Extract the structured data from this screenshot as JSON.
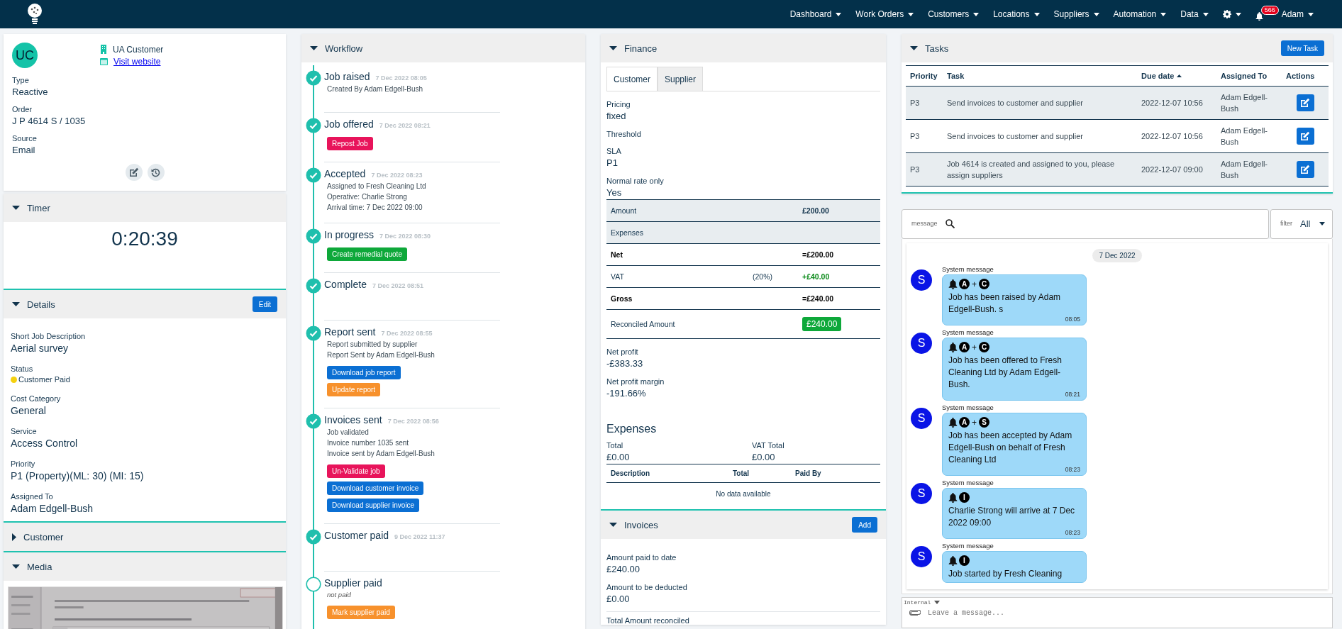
{
  "nav": {
    "items": [
      {
        "kind": "menu",
        "label": "Dashboard"
      },
      {
        "kind": "menu",
        "label": "Work Orders"
      },
      {
        "kind": "menu",
        "label": "Customers"
      },
      {
        "kind": "menu",
        "label": "Locations"
      },
      {
        "kind": "menu",
        "label": "Suppliers"
      },
      {
        "kind": "menu",
        "label": "Automation"
      },
      {
        "kind": "menu",
        "label": "Data"
      },
      {
        "kind": "settings"
      },
      {
        "kind": "notifications",
        "badge": "566"
      },
      {
        "kind": "menu",
        "label": "Adam"
      }
    ]
  },
  "customer_card": {
    "avatar": "UC",
    "name": "UA Customer",
    "link": "Visit website",
    "fields": [
      {
        "label": "Type",
        "value": "Reactive"
      },
      {
        "label": "Order",
        "value": "J P 4614 S / 1035"
      },
      {
        "label": "Source",
        "value": "Email"
      }
    ]
  },
  "timer": {
    "title": "Timer",
    "expanded": true,
    "time": "0:20:39"
  },
  "details": {
    "title": "Details",
    "expanded": true,
    "button": "Edit",
    "fields": [
      {
        "label": "Short Job Description",
        "value": "Aerial survey"
      },
      {
        "label": "Status",
        "value": "Customer Paid",
        "color": "#f5d10f"
      },
      {
        "label": "Cost Category",
        "value": "General"
      },
      {
        "label": "Service",
        "value": "Access Control"
      },
      {
        "label": "Priority",
        "value": "P1 (Property)(ML: 30) (MI: 15)"
      },
      {
        "label": "Assigned To",
        "value": "Adam Edgell-Bush"
      }
    ]
  },
  "customer_section": {
    "title": "Customer",
    "expanded": false
  },
  "media": {
    "title": "Media",
    "expanded": true
  },
  "workflow": {
    "title": "Workflow",
    "expanded": true,
    "steps": [
      {
        "title": "Job raised",
        "date": "7 Dec 2022 08:05",
        "done": true,
        "lines": [
          "Created By Adam Edgell-Bush"
        ]
      },
      {
        "title": "Job offered",
        "date": "7 Dec 2022 08:21",
        "done": true,
        "buttons": [
          {
            "label": "Repost Job",
            "color": "#e8145b"
          }
        ]
      },
      {
        "title": "Accepted",
        "date": "7 Dec 2022 08:23",
        "done": true,
        "lines": [
          "Assigned to Fresh Cleaning Ltd",
          "Operative: Charlie Strong",
          "Arrival time: 7 Dec 2022 09:00"
        ]
      },
      {
        "title": "In progress",
        "date": "7 Dec 2022 08:30",
        "done": true,
        "buttons": [
          {
            "label": "Create remedial quote",
            "color": "#0ea83a"
          }
        ]
      },
      {
        "title": "Complete",
        "date": "7 Dec 2022 08:51",
        "done": true
      },
      {
        "title": "Report sent",
        "date": "7 Dec 2022 08:55",
        "done": true,
        "lines": [
          "Report submitted by supplier",
          "Report Sent by Adam Edgell-Bush"
        ],
        "buttons": [
          {
            "label": "Download job report",
            "color": "#0b6fd3"
          },
          {
            "label": "Update report",
            "color": "#f7912c"
          }
        ]
      },
      {
        "title": "Invoices sent",
        "date": "7 Dec 2022 08:56",
        "done": true,
        "lines": [
          "Job validated",
          "Invoice number 1035 sent",
          "Invoice sent by Adam Edgell-Bush"
        ],
        "buttons": [
          {
            "label": "Un-Validate job",
            "color": "#e8145b"
          },
          {
            "label": "Download customer invoice",
            "color": "#0b6fd3"
          },
          {
            "label": "Download supplier invoice",
            "color": "#0b6fd3"
          }
        ]
      },
      {
        "title": "Customer paid",
        "date": "9 Dec 2022 11:37",
        "done": true
      },
      {
        "title": "Supplier paid",
        "done": false,
        "note": "not paid",
        "buttons": [
          {
            "label": "Mark supplier paid",
            "color": "#f7912c"
          }
        ]
      }
    ]
  },
  "finance": {
    "title": "Finance",
    "expanded": true,
    "tabs": [
      {
        "label": "Customer",
        "selected": true
      },
      {
        "label": "Supplier",
        "selected": false
      }
    ],
    "fields": [
      {
        "label": "Pricing",
        "value": "fixed"
      },
      {
        "label": "Threshold"
      },
      {
        "label": "SLA",
        "value": "P1"
      },
      {
        "label": "Normal rate only",
        "value": "Yes"
      }
    ],
    "rows": [
      {
        "kind": "shaded",
        "label": "Amount",
        "value": "£200.00"
      },
      {
        "kind": "shaded",
        "label": "Expenses"
      },
      {
        "kind": "total",
        "label": "Net",
        "value": "=£200.00"
      },
      {
        "kind": "added",
        "label": "VAT",
        "note": "(20%)",
        "value": "+£40.00"
      },
      {
        "kind": "total",
        "label": "Gross",
        "value": "=£240.00"
      },
      {
        "kind": "reconciled",
        "label": "Reconciled Amount",
        "value": "£240.00"
      }
    ],
    "profit": [
      {
        "label": "Net profit",
        "value": "-£383.33"
      },
      {
        "label": "Net profit margin",
        "value": "-191.66%"
      }
    ],
    "expenses": {
      "title": "Expenses",
      "totals": [
        {
          "label": "Total",
          "value": "£0.00"
        },
        {
          "label": "VAT Total",
          "value": "£0.00"
        }
      ],
      "columns": [
        "Description",
        "Total",
        "Paid By"
      ],
      "empty": "No data available"
    }
  },
  "invoices": {
    "title": "Invoices",
    "expanded": true,
    "button": "Add",
    "fields": [
      {
        "label": "Amount paid to date",
        "value": "£240.00"
      },
      {
        "label": "Amount to be deducted",
        "value": "£0.00"
      }
    ],
    "footer_label": "Total Amount reconciled"
  },
  "tasks": {
    "title": "Tasks",
    "expanded": true,
    "button": "New Task",
    "columns": [
      {
        "label": "Priority",
        "sorted": false
      },
      {
        "label": "Task",
        "sorted": false
      },
      {
        "label": "Due date",
        "sorted": true
      },
      {
        "label": "Assigned To",
        "sorted": false
      },
      {
        "label": "Actions",
        "sorted": false
      }
    ],
    "rows": [
      {
        "priority": "P3",
        "task": "Send invoices to customer and supplier",
        "due": "2022-12-07 10:56",
        "assigned": "Adam Edgell-Bush"
      },
      {
        "priority": "P3",
        "task": "Send invoices to customer and supplier",
        "due": "2022-12-07 10:56",
        "assigned": "Adam Edgell-Bush"
      },
      {
        "priority": "P3",
        "task": "Job 4614 is created and assigned to you, please assign suppliers",
        "due": "2022-12-07 09:00",
        "assigned": "Adam Edgell-Bush"
      }
    ]
  },
  "chat": {
    "search_label": "message",
    "filter_label": "filter",
    "filter_value": "All",
    "date_chip": "7 Dec 2022",
    "messages": [
      {
        "avatar": "S",
        "sender": "System message",
        "marks": [
          {
            "kind": "circle",
            "text": "A"
          },
          {
            "kind": "plain",
            "text": "+"
          },
          {
            "kind": "circle",
            "text": "C"
          }
        ],
        "text": "Job has been raised by Adam Edgell-Bush. s",
        "time": "08:05"
      },
      {
        "avatar": "S",
        "sender": "System message",
        "marks": [
          {
            "kind": "circle",
            "text": "A"
          },
          {
            "kind": "plain",
            "text": "+"
          },
          {
            "kind": "circle",
            "text": "C"
          }
        ],
        "text": "Job has been offered to Fresh Cleaning Ltd by Adam Edgell-Bush.",
        "time": "08:21"
      },
      {
        "avatar": "S",
        "sender": "System message",
        "marks": [
          {
            "kind": "circle",
            "text": "A"
          },
          {
            "kind": "plain",
            "text": "+"
          },
          {
            "kind": "circle",
            "text": "S"
          }
        ],
        "text": "Job has been accepted by Adam Edgell-Bush on behalf of Fresh Cleaning Ltd",
        "time": "08:23"
      },
      {
        "avatar": "S",
        "sender": "System message",
        "marks": [
          {
            "kind": "circle",
            "text": "I"
          }
        ],
        "text": "Charlie Strong will arrive at 7 Dec 2022 09:00",
        "time": "08:23"
      },
      {
        "avatar": "S",
        "sender": "System message",
        "marks": [
          {
            "kind": "circle",
            "text": "I"
          }
        ],
        "text": "Job started by Fresh Cleaning"
      }
    ],
    "composer": {
      "channel": "Internal",
      "placeholder": "Leave a message..."
    }
  }
}
